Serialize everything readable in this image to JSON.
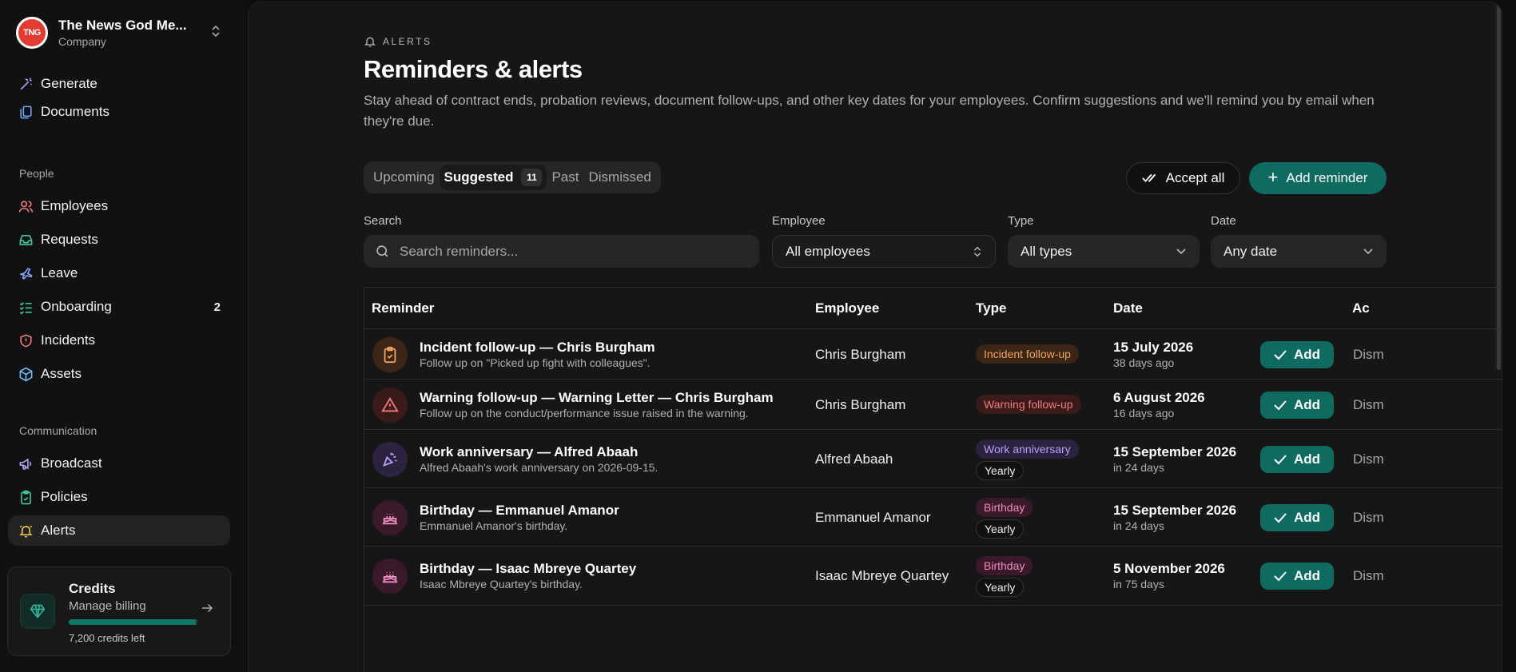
{
  "company": {
    "name": "The News God Me...",
    "type": "Company",
    "logo_text": "TNG"
  },
  "nav": {
    "top": [
      {
        "label": "Generate",
        "icon": "magic-wand-icon"
      },
      {
        "label": "Documents",
        "icon": "documents-icon"
      }
    ],
    "people_label": "People",
    "people": [
      {
        "label": "Employees",
        "icon": "users-icon"
      },
      {
        "label": "Requests",
        "icon": "inbox-icon"
      },
      {
        "label": "Leave",
        "icon": "plane-icon"
      },
      {
        "label": "Onboarding",
        "icon": "checklist-icon",
        "badge": "2"
      },
      {
        "label": "Incidents",
        "icon": "shield-alert-icon"
      },
      {
        "label": "Assets",
        "icon": "box-icon"
      }
    ],
    "communication_label": "Communication",
    "communication": [
      {
        "label": "Broadcast",
        "icon": "megaphone-icon"
      },
      {
        "label": "Policies",
        "icon": "clipboard-check-icon"
      },
      {
        "label": "Alerts",
        "icon": "bell-icon",
        "active": true
      }
    ]
  },
  "credits": {
    "title": "Credits",
    "subtitle": "Manage billing",
    "left": "7,200 credits left",
    "fill": 0.98
  },
  "header": {
    "eyebrow": "ALERTS",
    "title": "Reminders & alerts",
    "description": "Stay ahead of contract ends, probation reviews, document follow-ups, and other key dates for your employees. Confirm suggestions and we'll remind you by email when they're due."
  },
  "tabs": [
    {
      "label": "Upcoming"
    },
    {
      "label": "Suggested",
      "count": "11",
      "active": true
    },
    {
      "label": "Past"
    },
    {
      "label": "Dismissed"
    }
  ],
  "actions": {
    "accept_all": "Accept all",
    "add_reminder": "Add reminder"
  },
  "filters": {
    "search_label": "Search",
    "search_placeholder": "Search reminders...",
    "employee_label": "Employee",
    "employee_value": "All employees",
    "type_label": "Type",
    "type_value": "All types",
    "date_label": "Date",
    "date_value": "Any date"
  },
  "table": {
    "headers": {
      "reminder": "Reminder",
      "employee": "Employee",
      "type": "Type",
      "date": "Date",
      "actions": "Ac"
    },
    "add_label": "Add",
    "dismiss_label": "Dism",
    "rows": [
      {
        "title": "Incident follow-up — Chris Burgham",
        "subtitle": "Follow up on \"Picked up fight with colleagues\".",
        "employee": "Chris Burgham",
        "type": "Incident follow-up",
        "type_kind": "incident",
        "recurrence": "",
        "date": "15 July 2026",
        "relative": "38 days ago",
        "icon": "clipboard-icon"
      },
      {
        "title": "Warning follow-up — Warning Letter — Chris Burgham",
        "subtitle": "Follow up on the conduct/performance issue raised in the warning.",
        "employee": "Chris Burgham",
        "type": "Warning follow-up",
        "type_kind": "warning",
        "recurrence": "",
        "date": "6 August 2026",
        "relative": "16 days ago",
        "icon": "warning-triangle-icon"
      },
      {
        "title": "Work anniversary — Alfred Abaah",
        "subtitle": "Alfred Abaah's work anniversary on 2026-09-15.",
        "employee": "Alfred Abaah",
        "type": "Work anniversary",
        "type_kind": "anniv",
        "recurrence": "Yearly",
        "date": "15 September 2026",
        "relative": "in 24 days",
        "icon": "party-popper-icon"
      },
      {
        "title": "Birthday — Emmanuel Amanor",
        "subtitle": "Emmanuel Amanor's birthday.",
        "employee": "Emmanuel Amanor",
        "type": "Birthday",
        "type_kind": "birthday",
        "recurrence": "Yearly",
        "date": "15 September 2026",
        "relative": "in 24 days",
        "icon": "cake-icon"
      },
      {
        "title": "Birthday — Isaac Mbreye Quartey",
        "subtitle": "Isaac Mbreye Quartey's birthday.",
        "employee": "Isaac Mbreye Quartey",
        "type": "Birthday",
        "type_kind": "birthday",
        "recurrence": "Yearly",
        "date": "5 November 2026",
        "relative": "in 75 days",
        "icon": "cake-icon"
      }
    ]
  },
  "colors": {
    "accent": "#0f6b60",
    "background": "#0e0e0e",
    "panel": "#161616"
  }
}
